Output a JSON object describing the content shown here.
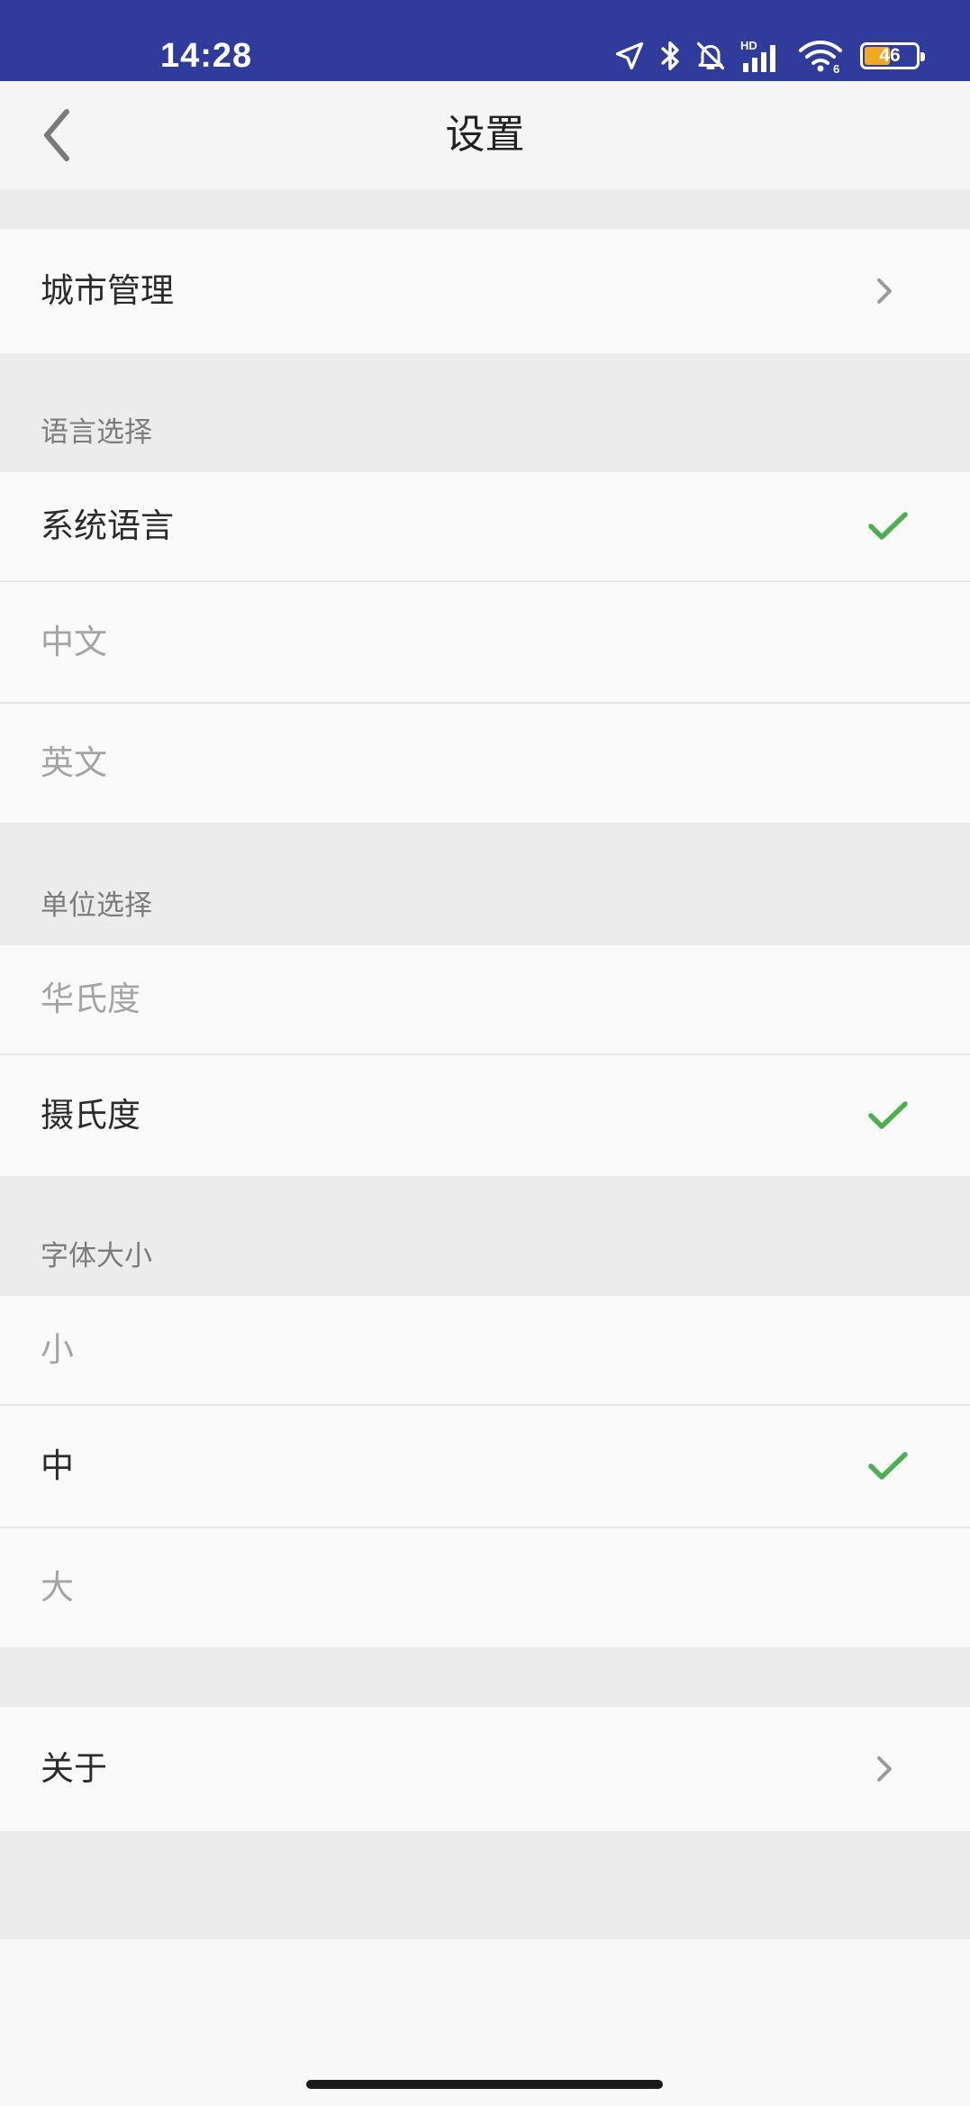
{
  "status_bar": {
    "time": "14:28",
    "network_badge": "HD",
    "wifi_badge": "6",
    "battery_level": "46",
    "battery_fraction": 0.46,
    "icons": [
      "location-arrow-icon",
      "bluetooth-icon",
      "bell-muted-icon",
      "signal-icon",
      "wifi-icon",
      "battery-icon"
    ]
  },
  "nav": {
    "back_icon": "back-chevron-icon",
    "title": "设置"
  },
  "rows": {
    "city_management": "城市管理",
    "about": "关于"
  },
  "language": {
    "header": "语言选择",
    "options": [
      {
        "label": "系统语言",
        "selected": true
      },
      {
        "label": "中文",
        "selected": false
      },
      {
        "label": "英文",
        "selected": false
      }
    ]
  },
  "unit": {
    "header": "单位选择",
    "options": [
      {
        "label": "华氏度",
        "selected": false
      },
      {
        "label": "摄氏度",
        "selected": true
      }
    ]
  },
  "font_size": {
    "header": "字体大小",
    "options": [
      {
        "label": "小",
        "selected": false
      },
      {
        "label": "中",
        "selected": true
      },
      {
        "label": "大",
        "selected": false
      }
    ]
  },
  "colors": {
    "status_bar": "#2f3c9c",
    "check": "#4caf50",
    "chevron": "#9a9a9a",
    "battery_fill": "#f1a822",
    "text_active": "#2b2b2b",
    "text_inactive": "#a4a4a4",
    "section_header_text": "#7c7c7c"
  }
}
